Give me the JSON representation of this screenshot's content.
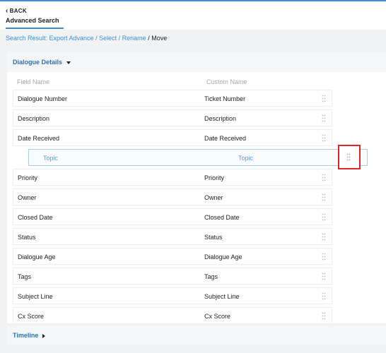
{
  "header": {
    "back_label": "BACK",
    "tab_label": "Advanced Search"
  },
  "breadcrumb": {
    "items": [
      "Search Result: Export Advance",
      "Select",
      "Rename"
    ],
    "current": "Move"
  },
  "dialogue_details": {
    "title": "Dialogue Details",
    "columns": {
      "field_name": "Field Name",
      "custom_name": "Custom Name"
    },
    "rows": [
      {
        "field": "Dialogue Number",
        "custom": "Ticket Number"
      },
      {
        "field": "Description",
        "custom": "Description"
      },
      {
        "field": "Date Received",
        "custom": "Date Received"
      },
      {
        "field": "Topic",
        "custom": "Topic",
        "dragging": true
      },
      {
        "field": "Priority",
        "custom": "Priority"
      },
      {
        "field": "Owner",
        "custom": "Owner"
      },
      {
        "field": "Closed Date",
        "custom": "Closed Date"
      },
      {
        "field": "Status",
        "custom": "Status"
      },
      {
        "field": "Dialogue Age",
        "custom": "Dialogue Age"
      },
      {
        "field": "Tags",
        "custom": "Tags"
      },
      {
        "field": "Subject Line",
        "custom": "Subject Line"
      },
      {
        "field": "Cx Score",
        "custom": "Cx Score"
      }
    ]
  },
  "timeline": {
    "title": "Timeline"
  },
  "colors": {
    "accent": "#3a8fd6",
    "title_blue": "#2f6fb2",
    "highlight": "#e02525",
    "drag_text": "#5b9bd6"
  },
  "icons": {
    "handle": "drag-handle-icon",
    "back": "chevron-left-icon",
    "expand": "caret-down-icon",
    "collapse": "caret-right-icon"
  }
}
